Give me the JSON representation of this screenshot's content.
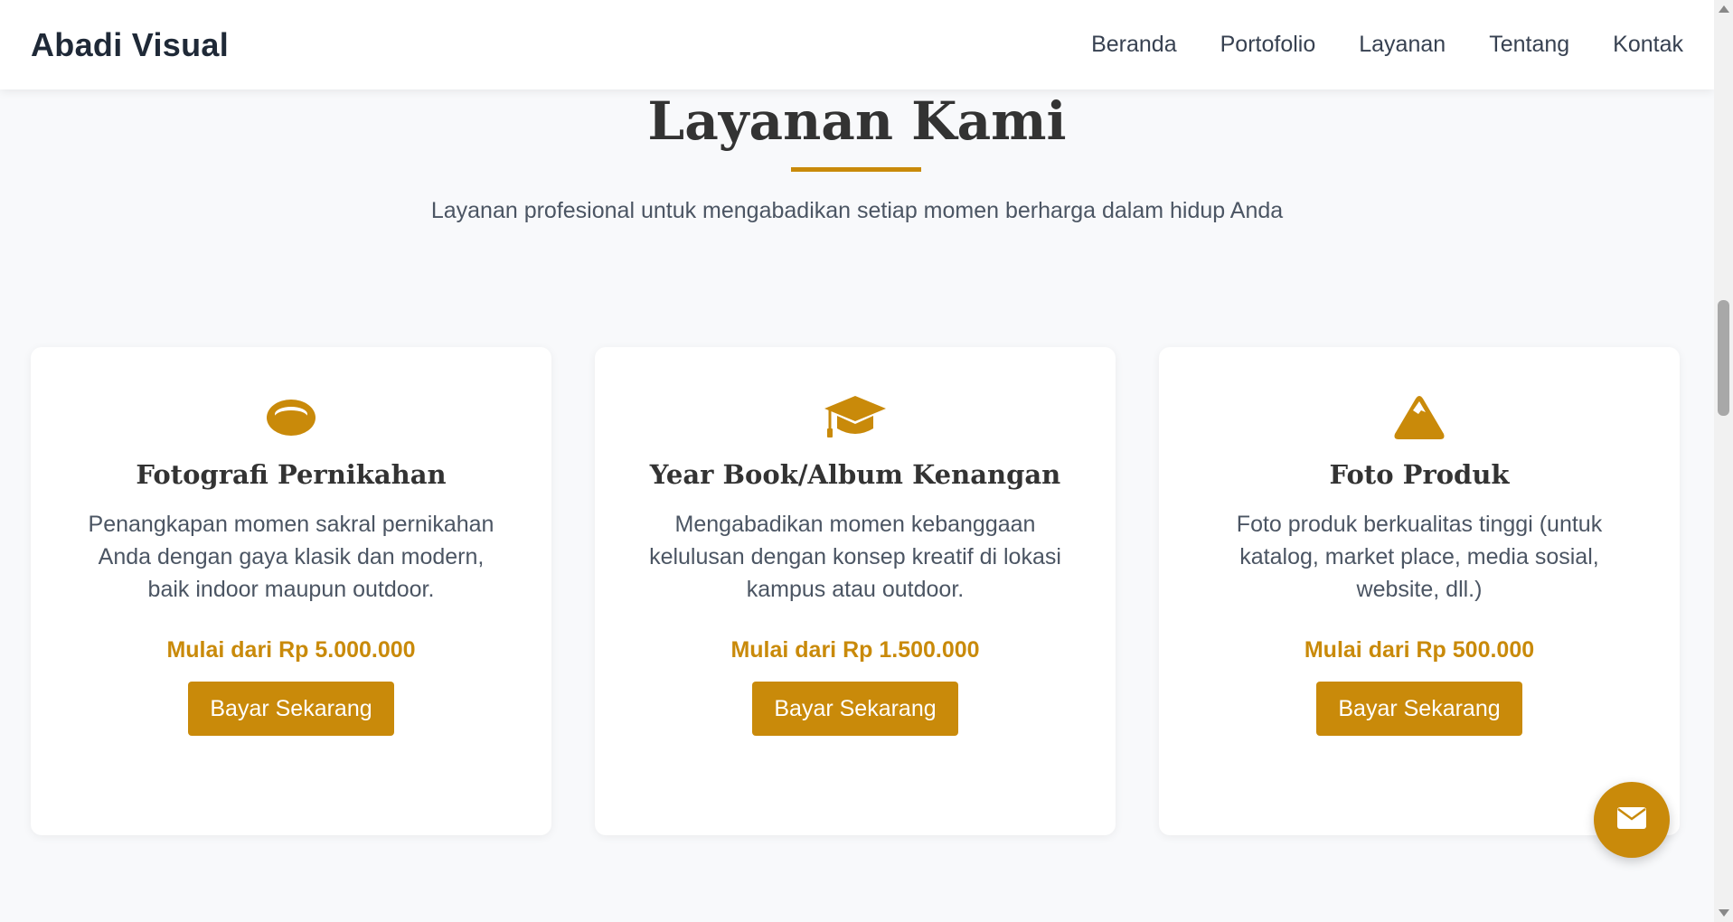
{
  "brand": "Abadi Visual",
  "nav": {
    "items": [
      {
        "label": "Beranda"
      },
      {
        "label": "Portofolio"
      },
      {
        "label": "Layanan"
      },
      {
        "label": "Tentang"
      },
      {
        "label": "Kontak"
      }
    ]
  },
  "section": {
    "title": "Layanan Kami",
    "subtitle": "Layanan profesional untuk mengabadikan setiap momen berharga dalam hidup Anda"
  },
  "cards": [
    {
      "icon": "ring-icon",
      "title": "Fotografi Pernikahan",
      "description": "Penangkapan momen sakral pernikahan Anda dengan gaya klasik dan modern, baik indoor maupun outdoor.",
      "price": "Mulai dari Rp 5.000.000",
      "button": "Bayar Sekarang"
    },
    {
      "icon": "graduation-cap-icon",
      "title": "Year Book/Album Kenangan",
      "description": "Mengabadikan momen kebanggaan kelulusan dengan konsep kreatif di lokasi kampus atau outdoor.",
      "price": "Mulai dari Rp 1.500.000",
      "button": "Bayar Sekarang"
    },
    {
      "icon": "mountain-icon",
      "title": "Foto Produk",
      "description": "Foto produk berkualitas tinggi (untuk katalog, market place, media sosial, website, dll.)",
      "price": "Mulai dari Rp 500.000",
      "button": "Bayar Sekarang"
    }
  ],
  "fab": {
    "icon": "envelope-icon"
  },
  "colors": {
    "accent": "#c98a0a",
    "background": "#f8f9fb",
    "text": "#333333"
  }
}
